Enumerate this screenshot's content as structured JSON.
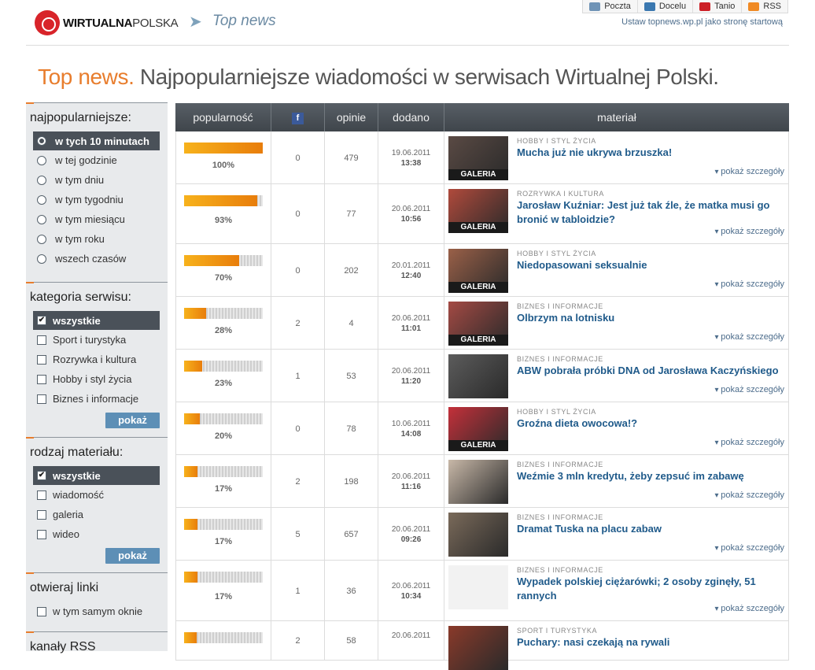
{
  "header": {
    "logo_bold": "WIRTUALNA",
    "logo_light": "POLSKA",
    "brand_title": "Top news",
    "links": [
      {
        "label": "Poczta",
        "icon": "mail-icon",
        "color": "#6f93b6"
      },
      {
        "label": "Docelu",
        "icon": "arrow-icon",
        "color": "#3b78b0"
      },
      {
        "label": "Tanio",
        "icon": "tag-icon",
        "color": "#cc1f26"
      },
      {
        "label": "RSS",
        "icon": "rss-icon",
        "color": "#f08a24"
      }
    ],
    "start_link": "Ustaw topnews.wp.pl jako stronę startową"
  },
  "page": {
    "heading_accent": "Top news.",
    "heading_rest": "Najpopularniejsze wiadomości w serwisach Wirtualnej Polski."
  },
  "sidebar": {
    "popular": {
      "title": "najpopularniejsze:",
      "options": [
        "w tych 10 minutach",
        "w tej godzinie",
        "w tym dniu",
        "w tym tygodniu",
        "w tym miesiącu",
        "w tym roku",
        "wszech czasów"
      ],
      "selected": 0
    },
    "category": {
      "title": "kategoria serwisu:",
      "options": [
        "wszystkie",
        "Sport i turystyka",
        "Rozrywka i kultura",
        "Hobby i styl życia",
        "Biznes i informacje"
      ],
      "checked": [
        true,
        false,
        false,
        false,
        false
      ],
      "button": "pokaż"
    },
    "material": {
      "title": "rodzaj materiału:",
      "options": [
        "wszystkie",
        "wiadomość",
        "galeria",
        "wideo"
      ],
      "checked": [
        true,
        false,
        false,
        false
      ],
      "button": "pokaż"
    },
    "links": {
      "title": "otwieraj linki",
      "options": [
        "w tym samym oknie"
      ],
      "checked": [
        false
      ]
    },
    "rss_title": "kanały RSS"
  },
  "table": {
    "headers": {
      "popularity": "popularność",
      "facebook": "f",
      "opinions": "opinie",
      "added": "dodano",
      "material": "materiał"
    },
    "gallery_label": "GALERIA",
    "more_label": "pokaż szczegóły",
    "rows": [
      {
        "popularity": 100,
        "pct": "100%",
        "fb": "0",
        "opinions": "479",
        "date": "19.06.2011",
        "time": "13:38",
        "category": "HOBBY I STYL ŻYCIA",
        "title": "Mucha już nie ukrywa brzuszka!",
        "gallery": true,
        "thumb": "#5a4a44"
      },
      {
        "popularity": 93,
        "pct": "93%",
        "fb": "0",
        "opinions": "77",
        "date": "20.06.2011",
        "time": "10:56",
        "category": "ROZRYWKA I KULTURA",
        "title": "Jarosław Kuźniar: Jest już tak źle, że matka musi go bronić w tabloidzie?",
        "gallery": true,
        "thumb": "#b04a3c"
      },
      {
        "popularity": 70,
        "pct": "70%",
        "fb": "0",
        "opinions": "202",
        "date": "20.01.2011",
        "time": "12:40",
        "category": "HOBBY I STYL ŻYCIA",
        "title": "Niedopasowani seksualnie",
        "gallery": true,
        "thumb": "#9a6048"
      },
      {
        "popularity": 28,
        "pct": "28%",
        "fb": "2",
        "opinions": "4",
        "date": "20.06.2011",
        "time": "11:01",
        "category": "BIZNES I INFORMACJE",
        "title": "Olbrzym na lotnisku",
        "gallery": true,
        "thumb": "#a44a44"
      },
      {
        "popularity": 23,
        "pct": "23%",
        "fb": "1",
        "opinions": "53",
        "date": "20.06.2011",
        "time": "11:20",
        "category": "BIZNES I INFORMACJE",
        "title": "ABW pobrała próbki DNA od Jarosława Kaczyńskiego",
        "gallery": false,
        "thumb": "#5c5c5c"
      },
      {
        "popularity": 20,
        "pct": "20%",
        "fb": "0",
        "opinions": "78",
        "date": "10.06.2011",
        "time": "14:08",
        "category": "HOBBY I STYL ŻYCIA",
        "title": "Groźna dieta owocowa!?",
        "gallery": true,
        "thumb": "#c4303a"
      },
      {
        "popularity": 17,
        "pct": "17%",
        "fb": "2",
        "opinions": "198",
        "date": "20.06.2011",
        "time": "11:16",
        "category": "BIZNES I INFORMACJE",
        "title": "Weźmie 3 mln kredytu, żeby zepsuć im zabawę",
        "gallery": false,
        "thumb": "#c8b8a8"
      },
      {
        "popularity": 17,
        "pct": "17%",
        "fb": "5",
        "opinions": "657",
        "date": "20.06.2011",
        "time": "09:26",
        "category": "BIZNES I INFORMACJE",
        "title": "Dramat Tuska na placu zabaw",
        "gallery": false,
        "thumb": "#7a6a5a"
      },
      {
        "popularity": 17,
        "pct": "17%",
        "fb": "1",
        "opinions": "36",
        "date": "20.06.2011",
        "time": "10:34",
        "category": "BIZNES I INFORMACJE",
        "title": "Wypadek polskiej ciężarówki; 2 osoby zginęły, 51 rannych",
        "gallery": false,
        "thumb": "#f0f0f0"
      },
      {
        "popularity": 16,
        "pct": "",
        "fb": "2",
        "opinions": "58",
        "date": "20.06.2011",
        "time": "",
        "category": "SPORT I TURYSTYKA",
        "title": "Puchary: nasi czekają na rywali",
        "gallery": false,
        "thumb": "#8a3a2a"
      }
    ]
  }
}
